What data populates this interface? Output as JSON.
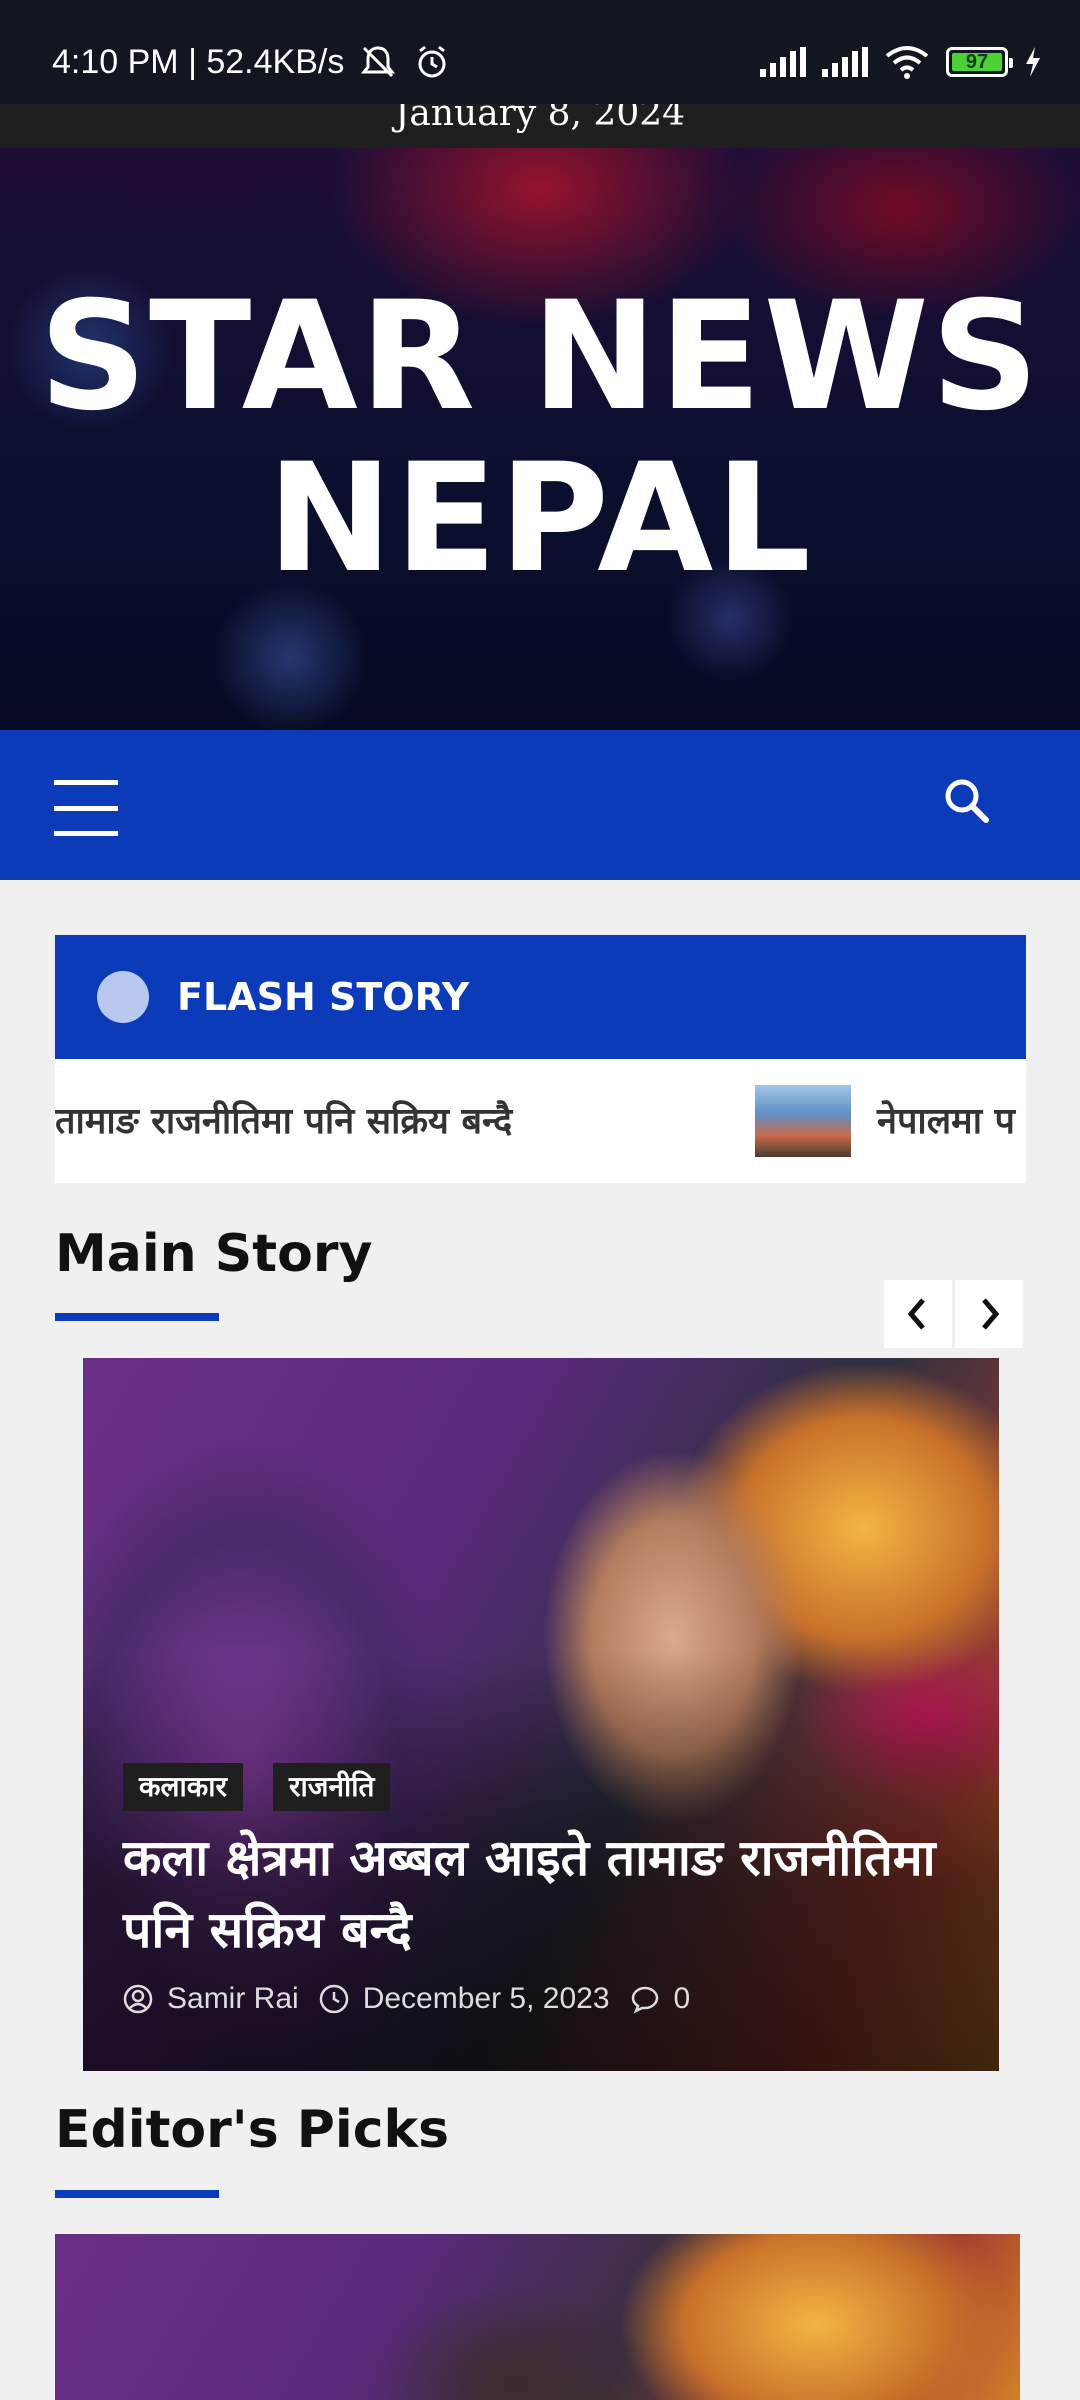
{
  "status_bar": {
    "time_speed": "4:10 PM | 52.4KB/s",
    "battery": "97"
  },
  "site": {
    "date": "January 8, 2024",
    "title_line1": "STAR NEWS",
    "title_line2": "NEPAL",
    "brand_color": "#0b3bb8"
  },
  "flash_story": {
    "label": "FLASH STORY",
    "ticker_item1": "तामाङ राजनीतिमा पनि सक्रिय बन्दै",
    "ticker_item2": "नेपालमा प"
  },
  "main_story": {
    "section_title": "Main Story",
    "tags": [
      "कलाकार",
      "राजनीति"
    ],
    "headline": "कला क्षेत्रमा अब्बल आइते तामाङ राजनीतिमा पनि सक्रिय बन्दै",
    "author": "Samir Rai",
    "date": "December 5, 2023",
    "comments": "0"
  },
  "editors_picks": {
    "section_title": "Editor's Picks"
  }
}
